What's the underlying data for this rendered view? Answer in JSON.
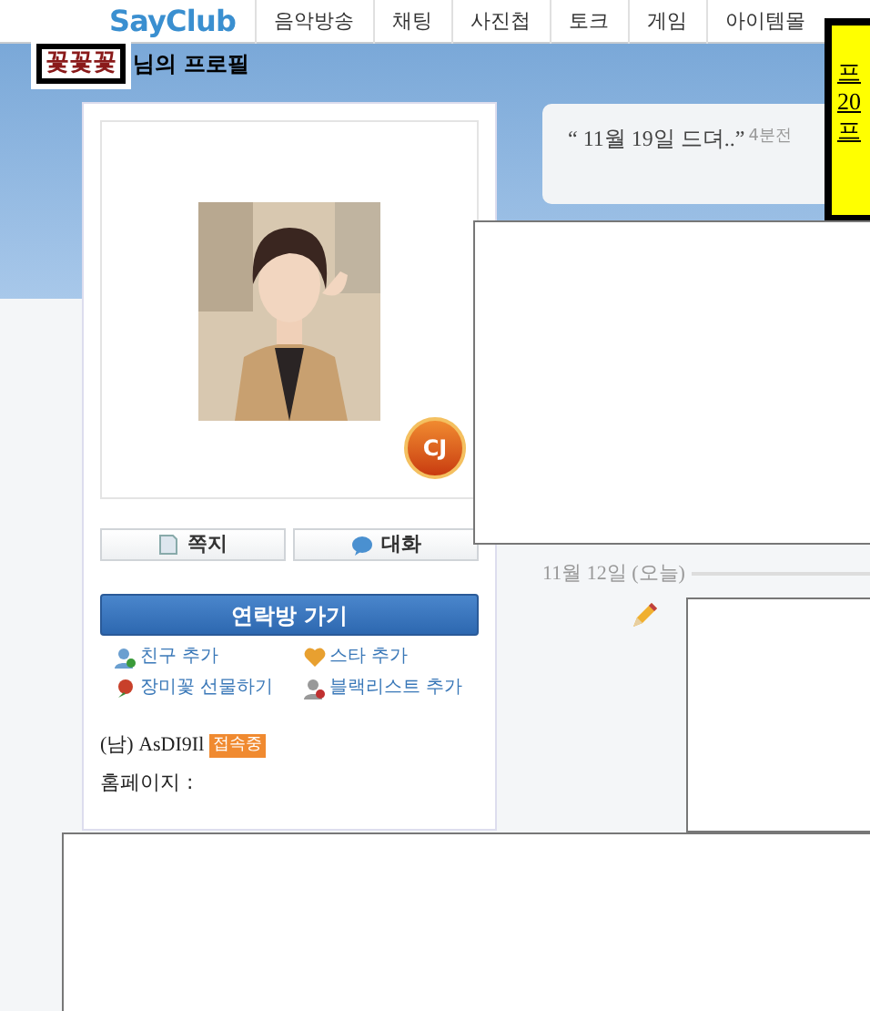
{
  "nav": {
    "logo": "SayClub",
    "items": [
      "음악방송",
      "채팅",
      "사진첩",
      "토크",
      "게임",
      "아이템몰"
    ]
  },
  "profile_header": {
    "nickname": "꽃꽃꽃",
    "title": "님의 프로필"
  },
  "status_bubble": {
    "open_quote": "“",
    "text": "11월 19일 드뎌..",
    "close_quote": "”",
    "time": "4분전"
  },
  "popup": {
    "lines": [
      "프",
      "20",
      "프"
    ]
  },
  "profile": {
    "badge": "CJ",
    "buttons": [
      {
        "kind": "note",
        "label": "쪽지"
      },
      {
        "kind": "chat",
        "label": "대화"
      }
    ],
    "contact_button": "연락방 가기",
    "links": [
      {
        "kind": "friend",
        "label": "친구 추가"
      },
      {
        "kind": "star",
        "label": "스타 추가"
      },
      {
        "kind": "rose",
        "label": "장미꽃 선물하기"
      },
      {
        "kind": "block",
        "label": "블랙리스트 추가"
      }
    ],
    "gender": "(남)",
    "user_id": "AsDI9Il",
    "online_badge": "접속중",
    "homepage_label": "홈페이지 :"
  },
  "timeline": {
    "date": "11월 12일 (오늘)"
  }
}
